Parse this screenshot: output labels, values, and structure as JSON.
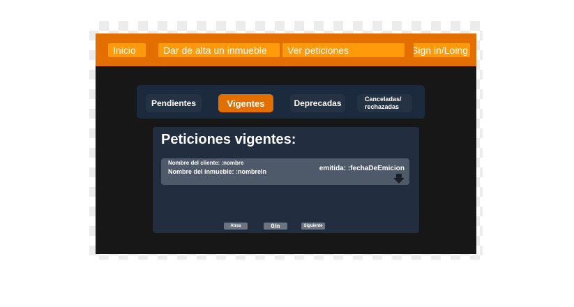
{
  "nav": {
    "home": "Inicio",
    "add_property": "Dar de alta un inmueble",
    "view_requests": "Ver peticiones",
    "sign_in": "Sign in/Loing"
  },
  "tabs": {
    "pending": "Pendientes",
    "active": "Vigentes",
    "deprecated": "Deprecadas",
    "cancelled_line1": "Canceladas/",
    "cancelled_line2": "rechazadas"
  },
  "main": {
    "title": "Peticiones vigentes:",
    "card": {
      "client": "Nombre del cliente: :nombre",
      "property": "Nombre del inmueble: :nombreIn",
      "issued": "emitida: :fechaDeEmicion"
    },
    "pager": {
      "prev": "Atras",
      "count": "0/n",
      "next": "Siguiente"
    }
  },
  "icons": {
    "card_action": "download-icon"
  },
  "colors": {
    "accent": "#e36f00",
    "nav_button": "#ff9b0a",
    "background": "#171717",
    "panel": "#222e3f"
  }
}
